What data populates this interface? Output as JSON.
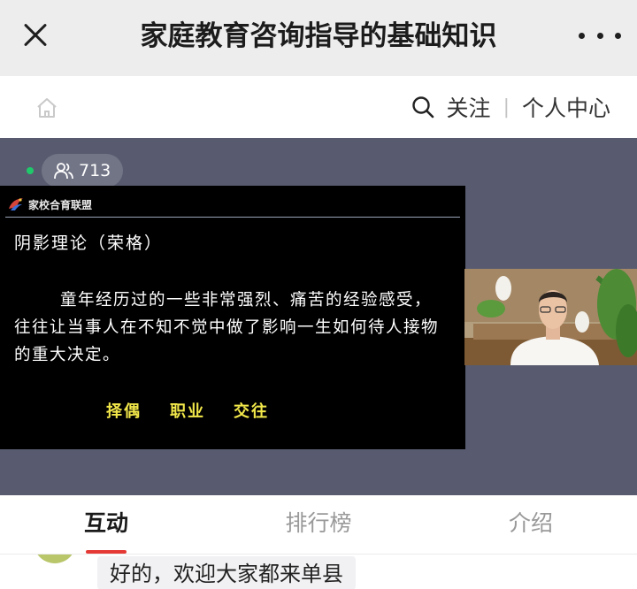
{
  "titlebar": {
    "title": "家庭教育咨询指导的基础知识"
  },
  "subheader": {
    "follow_label": "关注",
    "separator": "|",
    "profile_label": "个人中心"
  },
  "live": {
    "viewer_count": "713"
  },
  "slide": {
    "brand": "家校合育联盟",
    "heading": "阴影理论（荣格）",
    "body": "童年经历过的一些非常强烈、痛苦的经验感受，往往让当事人在不知不觉中做了影响一生如何待人接物的重大决定。",
    "keywords": [
      "择偶",
      "职业",
      "交往"
    ]
  },
  "tabs": [
    {
      "label": "互动",
      "active": true
    },
    {
      "label": "排行榜",
      "active": false
    },
    {
      "label": "介绍",
      "active": false
    }
  ],
  "chat": {
    "message": "好的，欢迎大家都来单县"
  },
  "colors": {
    "video_bg": "#585b6f",
    "keyword_yellow": "#f2e84a",
    "active_tab_underline": "#e53935",
    "live_dot": "#1fc96b"
  }
}
